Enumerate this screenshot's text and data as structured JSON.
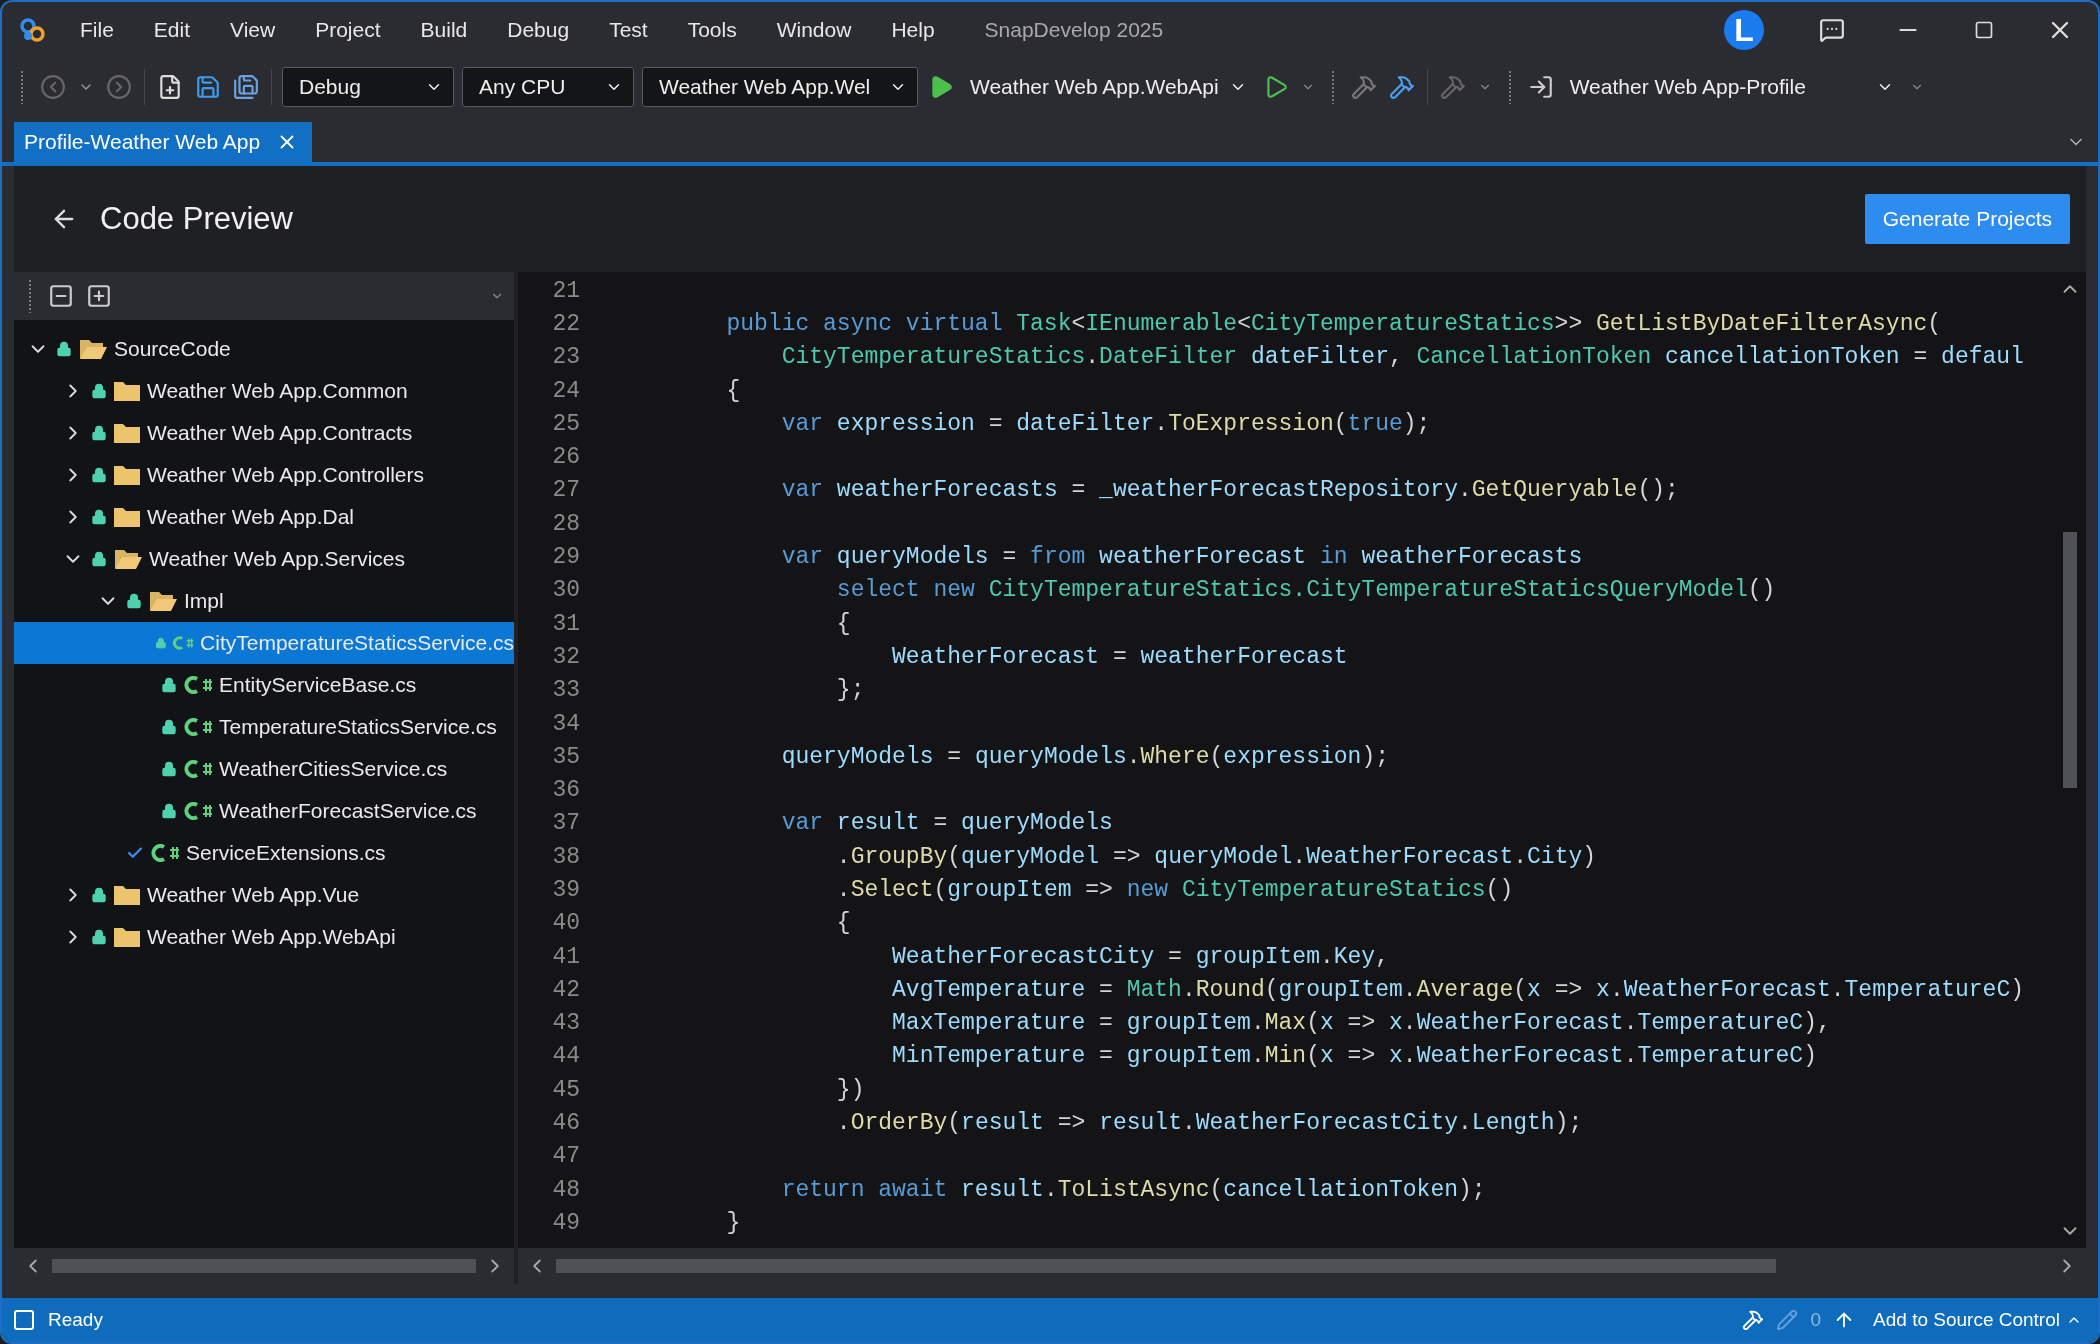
{
  "title_bar": {
    "menu": [
      "File",
      "Edit",
      "View",
      "Project",
      "Build",
      "Debug",
      "Test",
      "Tools",
      "Window",
      "Help"
    ],
    "app_title": "SnapDevelop 2025",
    "avatar": "L"
  },
  "toolbar": {
    "configuration": "Debug",
    "platform": "Any CPU",
    "startup_project": "Weather Web App.Wel",
    "run_target": "Weather Web App.WebApi",
    "profile": "Weather Web App-Profile"
  },
  "tabs": [
    {
      "label": "Profile-Weather Web App",
      "selected": true
    }
  ],
  "page": {
    "title": "Code Preview",
    "generate_button": "Generate Projects"
  },
  "tree": [
    {
      "label": "SourceCode",
      "kind": "folder",
      "locked": true,
      "checked": false,
      "expanded": true,
      "selected": false,
      "children": [
        {
          "label": "Weather Web App.Common",
          "kind": "folder",
          "locked": true,
          "checked": false,
          "expanded": false,
          "selected": false
        },
        {
          "label": "Weather Web App.Contracts",
          "kind": "folder",
          "locked": true,
          "checked": false,
          "expanded": false,
          "selected": false
        },
        {
          "label": "Weather Web App.Controllers",
          "kind": "folder",
          "locked": true,
          "checked": false,
          "expanded": false,
          "selected": false
        },
        {
          "label": "Weather Web App.Dal",
          "kind": "folder",
          "locked": true,
          "checked": false,
          "expanded": false,
          "selected": false
        },
        {
          "label": "Weather Web App.Services",
          "kind": "folder",
          "locked": true,
          "checked": false,
          "expanded": true,
          "selected": false,
          "children": [
            {
              "label": "Impl",
              "kind": "folder",
              "locked": true,
              "checked": false,
              "expanded": true,
              "selected": false,
              "children": [
                {
                  "label": "CityTemperatureStaticsService.cs",
                  "kind": "file",
                  "locked": true,
                  "checked": false,
                  "selected": true
                },
                {
                  "label": "EntityServiceBase.cs",
                  "kind": "file",
                  "locked": true,
                  "checked": false,
                  "selected": false
                },
                {
                  "label": "TemperatureStaticsService.cs",
                  "kind": "file",
                  "locked": true,
                  "checked": false,
                  "selected": false
                },
                {
                  "label": "WeatherCitiesService.cs",
                  "kind": "file",
                  "locked": true,
                  "checked": false,
                  "selected": false
                },
                {
                  "label": "WeatherForecastService.cs",
                  "kind": "file",
                  "locked": true,
                  "checked": false,
                  "selected": false
                }
              ]
            },
            {
              "label": "ServiceExtensions.cs",
              "kind": "file",
              "locked": false,
              "checked": true,
              "selected": false
            }
          ]
        },
        {
          "label": "Weather Web App.Vue",
          "kind": "folder",
          "locked": true,
          "checked": false,
          "expanded": false,
          "selected": false
        },
        {
          "label": "Weather Web App.WebApi",
          "kind": "folder",
          "locked": true,
          "checked": false,
          "expanded": false,
          "selected": false
        }
      ]
    }
  ],
  "editor": {
    "lines": [
      {
        "number": "21"
      },
      {
        "number": "22",
        "tokens": [
          {
            "kind": "keyword",
            "text": "        public async virtual "
          },
          {
            "kind": "type",
            "text": "Task"
          },
          {
            "kind": "plain",
            "text": "<"
          },
          {
            "kind": "type",
            "text": "IEnumerable"
          },
          {
            "kind": "plain",
            "text": "<"
          },
          {
            "kind": "type",
            "text": "CityTemperatureStatics"
          },
          {
            "kind": "plain",
            "text": ">> "
          },
          {
            "kind": "method",
            "text": "GetListByDateFilterAsync"
          },
          {
            "kind": "plain",
            "text": "("
          }
        ]
      },
      {
        "number": "23",
        "tokens": [
          {
            "kind": "type",
            "text": "            CityTemperatureStatics"
          },
          {
            "kind": "plain",
            "text": "."
          },
          {
            "kind": "type",
            "text": "DateFilter "
          },
          {
            "kind": "variable",
            "text": "dateFilter"
          },
          {
            "kind": "plain",
            "text": ", "
          },
          {
            "kind": "type",
            "text": "CancellationToken "
          },
          {
            "kind": "variable",
            "text": "cancellationToken"
          },
          {
            "kind": "plain",
            "text": " = "
          },
          {
            "kind": "variable",
            "text": "defaul"
          }
        ]
      },
      {
        "number": "24",
        "tokens": [
          {
            "kind": "plain",
            "text": "        {"
          }
        ]
      },
      {
        "number": "25",
        "tokens": [
          {
            "kind": "keyword",
            "text": "            var "
          },
          {
            "kind": "variable",
            "text": "expression"
          },
          {
            "kind": "plain",
            "text": " = "
          },
          {
            "kind": "variable",
            "text": "dateFilter"
          },
          {
            "kind": "plain",
            "text": "."
          },
          {
            "kind": "method",
            "text": "ToExpression"
          },
          {
            "kind": "plain",
            "text": "("
          },
          {
            "kind": "keyword",
            "text": "true"
          },
          {
            "kind": "plain",
            "text": ");"
          }
        ]
      },
      {
        "number": "26"
      },
      {
        "number": "27",
        "tokens": [
          {
            "kind": "keyword",
            "text": "            var "
          },
          {
            "kind": "variable",
            "text": "weatherForecasts"
          },
          {
            "kind": "plain",
            "text": " = "
          },
          {
            "kind": "variable",
            "text": "_weatherForecastRepository"
          },
          {
            "kind": "plain",
            "text": "."
          },
          {
            "kind": "method",
            "text": "GetQueryable"
          },
          {
            "kind": "plain",
            "text": "();"
          }
        ]
      },
      {
        "number": "28"
      },
      {
        "number": "29",
        "tokens": [
          {
            "kind": "keyword",
            "text": "            var "
          },
          {
            "kind": "variable",
            "text": "queryModels"
          },
          {
            "kind": "plain",
            "text": " = "
          },
          {
            "kind": "keyword",
            "text": "from "
          },
          {
            "kind": "variable",
            "text": "weatherForecast "
          },
          {
            "kind": "keyword",
            "text": "in "
          },
          {
            "kind": "variable",
            "text": "weatherForecasts"
          }
        ]
      },
      {
        "number": "30",
        "tokens": [
          {
            "kind": "keyword",
            "text": "                select new "
          },
          {
            "kind": "type",
            "text": "CityTemperatureStatics"
          },
          {
            "kind": "type",
            "text": ".CityTemperatureStaticsQueryModel"
          },
          {
            "kind": "plain",
            "text": "()"
          }
        ]
      },
      {
        "number": "31",
        "tokens": [
          {
            "kind": "plain",
            "text": "                {"
          }
        ]
      },
      {
        "number": "32",
        "tokens": [
          {
            "kind": "variable",
            "text": "                    WeatherForecast"
          },
          {
            "kind": "plain",
            "text": " = "
          },
          {
            "kind": "variable",
            "text": "weatherForecast"
          }
        ]
      },
      {
        "number": "33",
        "tokens": [
          {
            "kind": "plain",
            "text": "                };"
          }
        ]
      },
      {
        "number": "34"
      },
      {
        "number": "35",
        "tokens": [
          {
            "kind": "variable",
            "text": "            queryModels"
          },
          {
            "kind": "plain",
            "text": " = "
          },
          {
            "kind": "variable",
            "text": "queryModels"
          },
          {
            "kind": "plain",
            "text": "."
          },
          {
            "kind": "method",
            "text": "Where"
          },
          {
            "kind": "plain",
            "text": "("
          },
          {
            "kind": "variable",
            "text": "expression"
          },
          {
            "kind": "plain",
            "text": ");"
          }
        ]
      },
      {
        "number": "36"
      },
      {
        "number": "37",
        "tokens": [
          {
            "kind": "keyword",
            "text": "            var "
          },
          {
            "kind": "variable",
            "text": "result"
          },
          {
            "kind": "plain",
            "text": " = "
          },
          {
            "kind": "variable",
            "text": "queryModels"
          }
        ]
      },
      {
        "number": "38",
        "tokens": [
          {
            "kind": "plain",
            "text": "                ."
          },
          {
            "kind": "method",
            "text": "GroupBy"
          },
          {
            "kind": "plain",
            "text": "("
          },
          {
            "kind": "variable",
            "text": "queryModel"
          },
          {
            "kind": "plain",
            "text": " => "
          },
          {
            "kind": "variable",
            "text": "queryModel"
          },
          {
            "kind": "plain",
            "text": "."
          },
          {
            "kind": "variable",
            "text": "WeatherForecast"
          },
          {
            "kind": "plain",
            "text": "."
          },
          {
            "kind": "variable",
            "text": "City"
          },
          {
            "kind": "plain",
            "text": ")"
          }
        ]
      },
      {
        "number": "39",
        "tokens": [
          {
            "kind": "plain",
            "text": "                ."
          },
          {
            "kind": "method",
            "text": "Select"
          },
          {
            "kind": "plain",
            "text": "("
          },
          {
            "kind": "variable",
            "text": "groupItem"
          },
          {
            "kind": "plain",
            "text": " => "
          },
          {
            "kind": "keyword",
            "text": "new "
          },
          {
            "kind": "type",
            "text": "CityTemperatureStatics"
          },
          {
            "kind": "plain",
            "text": "()"
          }
        ]
      },
      {
        "number": "40",
        "tokens": [
          {
            "kind": "plain",
            "text": "                {"
          }
        ]
      },
      {
        "number": "41",
        "tokens": [
          {
            "kind": "variable",
            "text": "                    WeatherForecastCity"
          },
          {
            "kind": "plain",
            "text": " = "
          },
          {
            "kind": "variable",
            "text": "groupItem"
          },
          {
            "kind": "plain",
            "text": "."
          },
          {
            "kind": "variable",
            "text": "Key"
          },
          {
            "kind": "plain",
            "text": ","
          }
        ]
      },
      {
        "number": "42",
        "tokens": [
          {
            "kind": "variable",
            "text": "                    AvgTemperature"
          },
          {
            "kind": "plain",
            "text": " = "
          },
          {
            "kind": "type",
            "text": "Math"
          },
          {
            "kind": "plain",
            "text": "."
          },
          {
            "kind": "method",
            "text": "Round"
          },
          {
            "kind": "plain",
            "text": "("
          },
          {
            "kind": "variable",
            "text": "groupItem"
          },
          {
            "kind": "plain",
            "text": "."
          },
          {
            "kind": "method",
            "text": "Average"
          },
          {
            "kind": "plain",
            "text": "("
          },
          {
            "kind": "variable",
            "text": "x"
          },
          {
            "kind": "plain",
            "text": " => "
          },
          {
            "kind": "variable",
            "text": "x"
          },
          {
            "kind": "plain",
            "text": "."
          },
          {
            "kind": "variable",
            "text": "WeatherForecast"
          },
          {
            "kind": "plain",
            "text": "."
          },
          {
            "kind": "variable",
            "text": "TemperatureC"
          },
          {
            "kind": "plain",
            "text": ")"
          }
        ]
      },
      {
        "number": "43",
        "tokens": [
          {
            "kind": "variable",
            "text": "                    MaxTemperature"
          },
          {
            "kind": "plain",
            "text": " = "
          },
          {
            "kind": "variable",
            "text": "groupItem"
          },
          {
            "kind": "plain",
            "text": "."
          },
          {
            "kind": "method",
            "text": "Max"
          },
          {
            "kind": "plain",
            "text": "("
          },
          {
            "kind": "variable",
            "text": "x"
          },
          {
            "kind": "plain",
            "text": " => "
          },
          {
            "kind": "variable",
            "text": "x"
          },
          {
            "kind": "plain",
            "text": "."
          },
          {
            "kind": "variable",
            "text": "WeatherForecast"
          },
          {
            "kind": "plain",
            "text": "."
          },
          {
            "kind": "variable",
            "text": "TemperatureC"
          },
          {
            "kind": "plain",
            "text": "),"
          }
        ]
      },
      {
        "number": "44",
        "tokens": [
          {
            "kind": "variable",
            "text": "                    MinTemperature"
          },
          {
            "kind": "plain",
            "text": " = "
          },
          {
            "kind": "variable",
            "text": "groupItem"
          },
          {
            "kind": "plain",
            "text": "."
          },
          {
            "kind": "method",
            "text": "Min"
          },
          {
            "kind": "plain",
            "text": "("
          },
          {
            "kind": "variable",
            "text": "x"
          },
          {
            "kind": "plain",
            "text": " => "
          },
          {
            "kind": "variable",
            "text": "x"
          },
          {
            "kind": "plain",
            "text": "."
          },
          {
            "kind": "variable",
            "text": "WeatherForecast"
          },
          {
            "kind": "plain",
            "text": "."
          },
          {
            "kind": "variable",
            "text": "TemperatureC"
          },
          {
            "kind": "plain",
            "text": ")"
          }
        ]
      },
      {
        "number": "45",
        "tokens": [
          {
            "kind": "plain",
            "text": "                })"
          }
        ]
      },
      {
        "number": "46",
        "tokens": [
          {
            "kind": "plain",
            "text": "                ."
          },
          {
            "kind": "method",
            "text": "OrderBy"
          },
          {
            "kind": "plain",
            "text": "("
          },
          {
            "kind": "variable",
            "text": "result"
          },
          {
            "kind": "plain",
            "text": " => "
          },
          {
            "kind": "variable",
            "text": "result"
          },
          {
            "kind": "plain",
            "text": "."
          },
          {
            "kind": "variable",
            "text": "WeatherForecastCity"
          },
          {
            "kind": "plain",
            "text": "."
          },
          {
            "kind": "variable",
            "text": "Length"
          },
          {
            "kind": "plain",
            "text": ");"
          }
        ]
      },
      {
        "number": "47"
      },
      {
        "number": "48",
        "tokens": [
          {
            "kind": "keyword",
            "text": "            return await "
          },
          {
            "kind": "variable",
            "text": "result"
          },
          {
            "kind": "plain",
            "text": "."
          },
          {
            "kind": "method",
            "text": "ToListAsync"
          },
          {
            "kind": "plain",
            "text": "("
          },
          {
            "kind": "variable",
            "text": "cancellationToken"
          },
          {
            "kind": "plain",
            "text": ");"
          }
        ]
      },
      {
        "number": "49",
        "tokens": [
          {
            "kind": "plain",
            "text": "        }"
          }
        ]
      }
    ]
  },
  "status_bar": {
    "state": "Ready",
    "pending_count": "0",
    "source_control": "Add to Source Control"
  }
}
